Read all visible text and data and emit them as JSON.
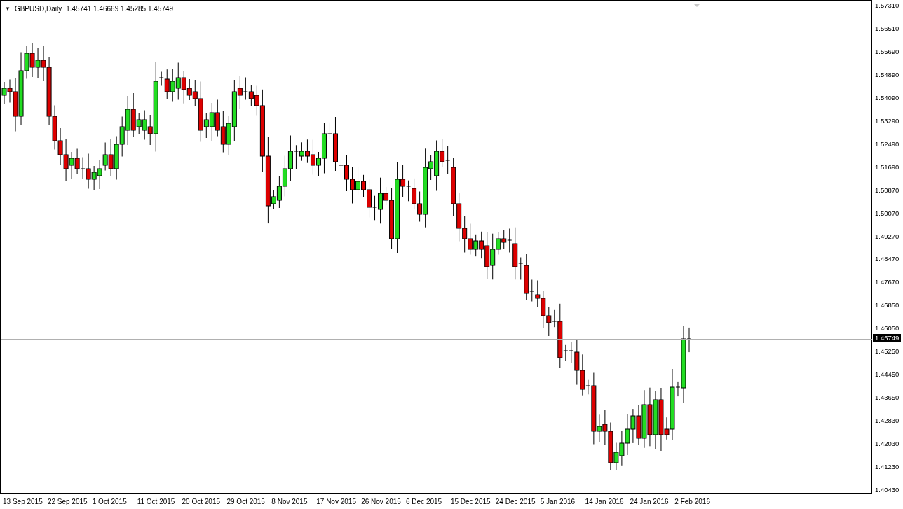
{
  "chart": {
    "menu_glyph": "▼",
    "symbol": "GBPUSD,Daily",
    "quote": "1.45741 1.46669 1.45285 1.45749"
  },
  "price_axis": {
    "labels": [
      "1.57310",
      "1.56510",
      "1.55690",
      "1.54890",
      "1.54090",
      "1.53290",
      "1.52490",
      "1.51690",
      "1.50870",
      "1.50070",
      "1.49270",
      "1.48470",
      "1.47670",
      "1.46850",
      "1.46050",
      "1.45250",
      "1.44450",
      "1.43650",
      "1.42830",
      "1.42030",
      "1.41230",
      "1.40430"
    ],
    "current_price": "1.45749"
  },
  "time_axis": {
    "labels": [
      "13 Sep 2015",
      "22 Sep 2015",
      "1 Oct 2015",
      "11 Oct 2015",
      "20 Oct 2015",
      "29 Oct 2015",
      "8 Nov 2015",
      "17 Nov 2015",
      "26 Nov 2015",
      "6 Dec 2015",
      "15 Dec 2015",
      "24 Dec 2015",
      "5 Jan 2016",
      "14 Jan 2016",
      "24 Jan 2016",
      "2 Feb 2016"
    ]
  }
}
